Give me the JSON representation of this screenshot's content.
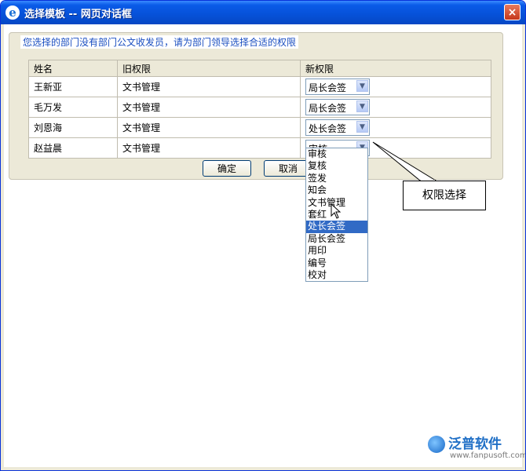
{
  "window": {
    "title": "选择模板  --  网页对话框",
    "close_label": "×"
  },
  "form": {
    "legend": "您选择的部门没有部门公文收发员，请为部门领导选择合适的权限",
    "columns": [
      "姓名",
      "旧权限",
      "新权限"
    ],
    "rows": [
      {
        "name": "王新亚",
        "old": "文书管理",
        "new": "局长会签"
      },
      {
        "name": "毛万发",
        "old": "文书管理",
        "new": "局长会签"
      },
      {
        "name": "刘恩海",
        "old": "文书管理",
        "new": "处长会签"
      },
      {
        "name": "赵益晨",
        "old": "文书管理",
        "new": "审核"
      }
    ],
    "ok_label": "确定",
    "cancel_label": "取消"
  },
  "dropdown": {
    "options": [
      "审核",
      "复核",
      "签发",
      "知会",
      "文书管理",
      "套红",
      "处长会签",
      "局长会签",
      "用印",
      "编号",
      "校对"
    ],
    "highlighted": "处长会签"
  },
  "callout": {
    "text": "权限选择"
  },
  "watermark": {
    "brand": "泛普软件",
    "url": "www.fanpusoft.com"
  },
  "colors": {
    "titlebar": "#0651d8",
    "highlight": "#316ac5",
    "legend_text": "#1a4ec0",
    "brand": "#1f6fc6"
  }
}
